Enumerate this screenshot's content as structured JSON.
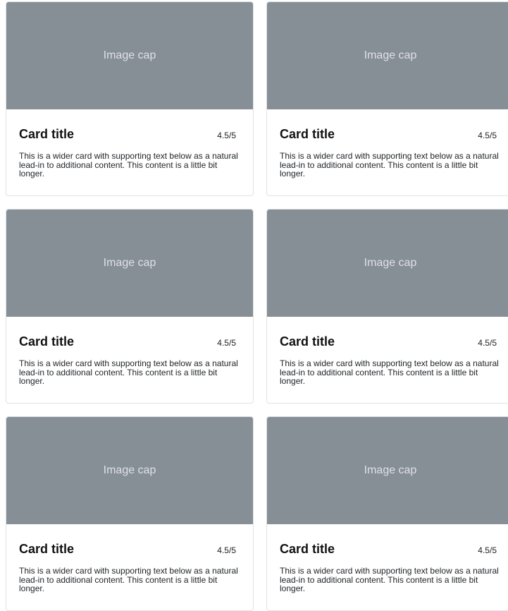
{
  "cards": [
    {
      "image_label": "Image cap",
      "title": "Card title",
      "rating": "4.5/5",
      "text": "This is a wider card with supporting text below as a natural lead-in to additional content. This content is a little bit longer."
    },
    {
      "image_label": "Image cap",
      "title": "Card title",
      "rating": "4.5/5",
      "text": "This is a wider card with supporting text below as a natural lead-in to additional content. This content is a little bit longer."
    },
    {
      "image_label": "Image cap",
      "title": "Card title",
      "rating": "4.5/5",
      "text": "This is a wider card with supporting text below as a natural lead-in to additional content. This content is a little bit longer."
    },
    {
      "image_label": "Image cap",
      "title": "Card title",
      "rating": "4.5/5",
      "text": "This is a wider card with supporting text below as a natural lead-in to additional content. This content is a little bit longer."
    },
    {
      "image_label": "Image cap",
      "title": "Card title",
      "rating": "4.5/5",
      "text": "This is a wider card with supporting text below as a natural lead-in to additional content. This content is a little bit longer."
    },
    {
      "image_label": "Image cap",
      "title": "Card title",
      "rating": "4.5/5",
      "text": "This is a wider card with supporting text below as a natural lead-in to additional content. This content is a little bit longer."
    }
  ],
  "colors": {
    "image_placeholder": "#868e96",
    "image_label": "#dee2e6",
    "card_border": "#dfe2e5"
  }
}
